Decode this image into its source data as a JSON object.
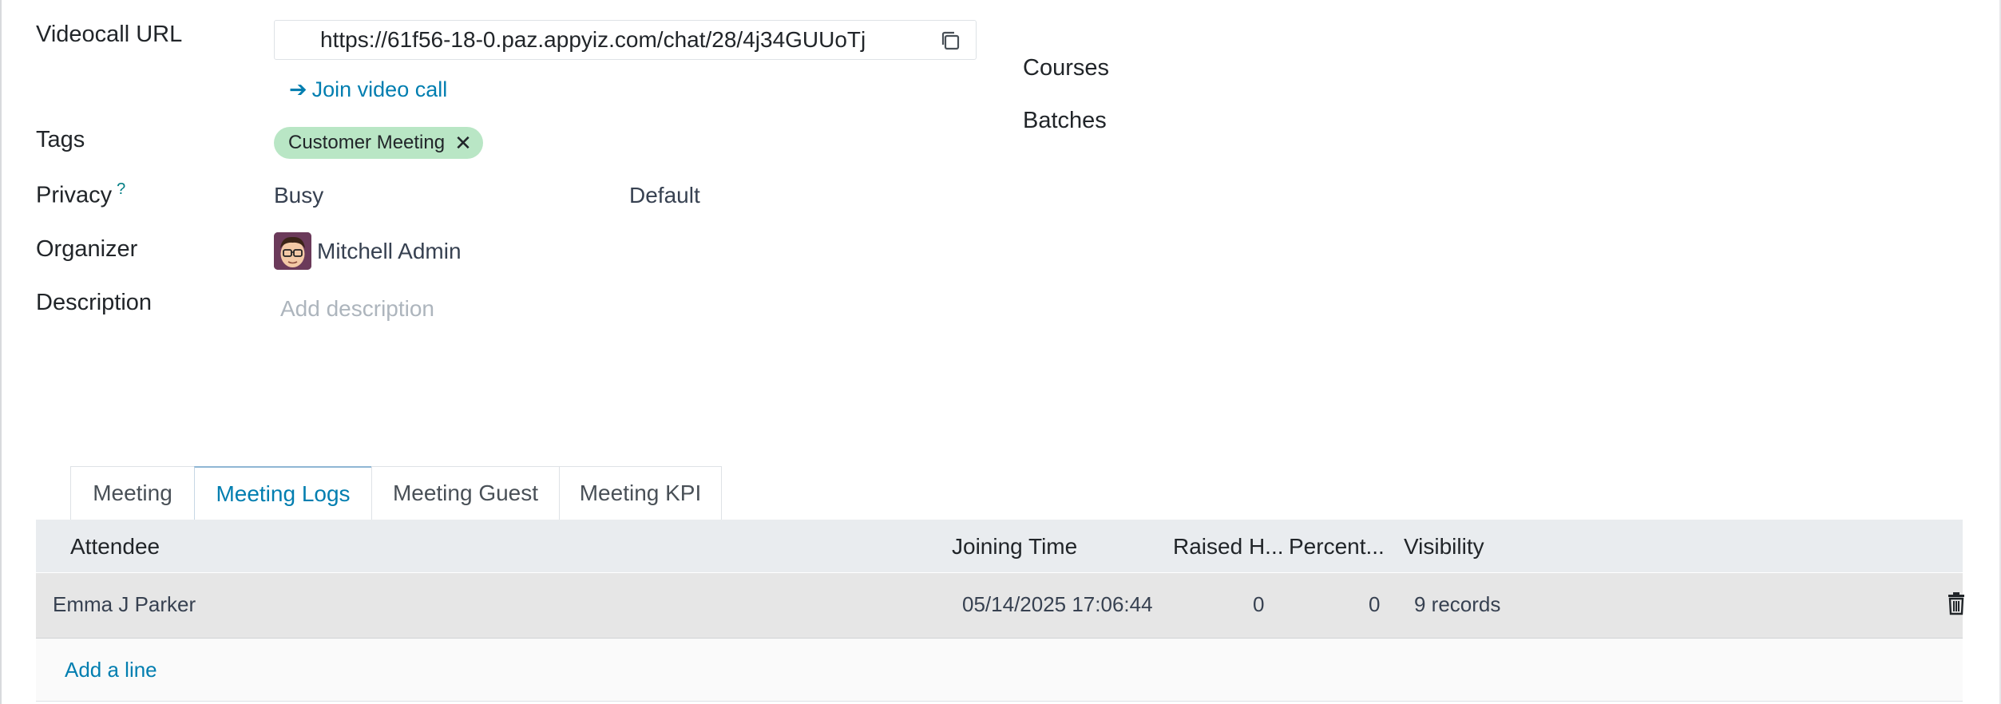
{
  "form": {
    "videocall_label": "Videocall URL",
    "videocall_url": "https://61f56-18-0.paz.appyiz.com/chat/28/4j34GUUoTj",
    "join_link": "Join video call",
    "tags_label": "Tags",
    "tag": "Customer Meeting",
    "privacy_label": "Privacy",
    "privacy_help": "?",
    "show_as": "Busy",
    "privacy_value": "Default",
    "organizer_label": "Organizer",
    "organizer_name": "Mitchell Admin",
    "description_label": "Description",
    "description_placeholder": "Add description",
    "courses_label": "Courses",
    "batches_label": "Batches"
  },
  "tabs": [
    {
      "label": "Meeting",
      "active": false
    },
    {
      "label": "Meeting Logs",
      "active": true
    },
    {
      "label": "Meeting Guest",
      "active": false
    },
    {
      "label": "Meeting KPI",
      "active": false
    }
  ],
  "table": {
    "columns": [
      "Attendee",
      "Joining Time",
      "Raised H...",
      "Percent...",
      "Visibility"
    ],
    "rows": [
      {
        "attendee": "Emma J Parker",
        "joining_time": "05/14/2025 17:06:44",
        "raised_hands": "0",
        "percent": "0",
        "visibility": "9 records"
      }
    ],
    "add_line": "Add a line"
  },
  "colors": {
    "link": "#017eb0",
    "tag_bg": "#b9e6c5",
    "header_bg": "#e9ecef",
    "row_bg": "#e6e6e6"
  }
}
